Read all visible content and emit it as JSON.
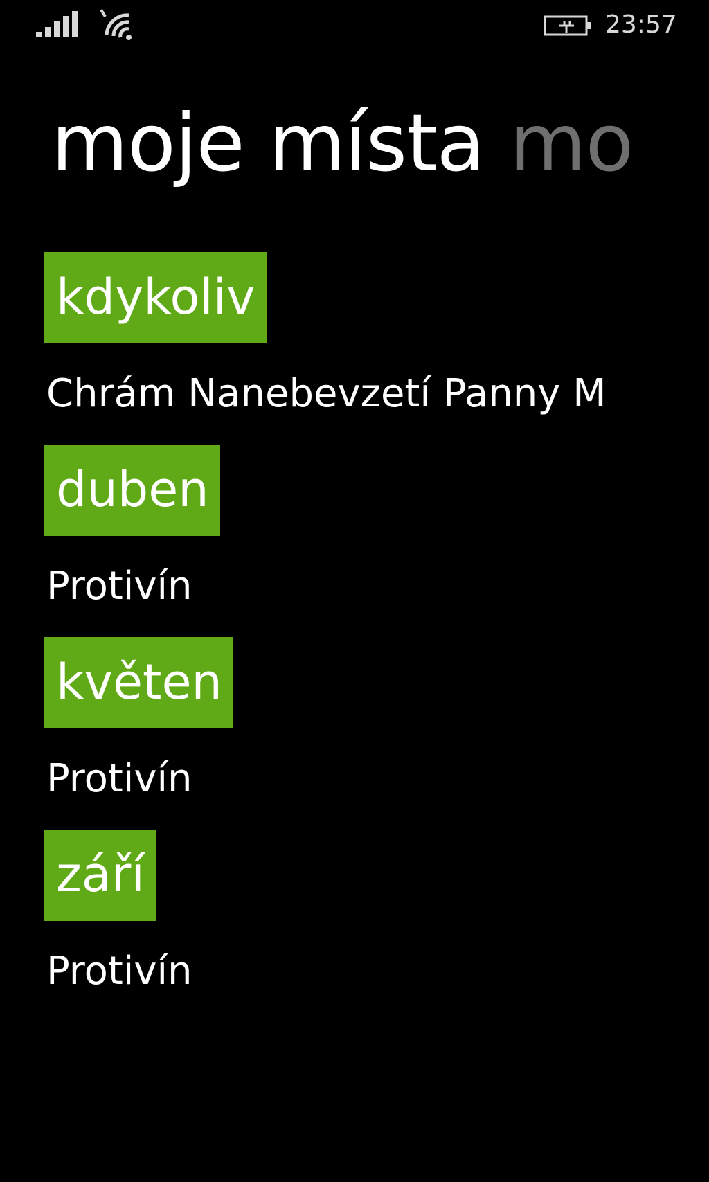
{
  "status_bar": {
    "time": "23:57",
    "icons": [
      "signal-icon",
      "wifi-icon",
      "battery-charging-icon"
    ]
  },
  "pivot": {
    "active_title": "moje místa",
    "next_title": "mo"
  },
  "colors": {
    "accent": "#60a917",
    "background": "#000000",
    "text": "#ffffff",
    "inactive_header": "#6f6f6f"
  },
  "groups": [
    {
      "label": "kdykoliv",
      "place": "Chrám Nanebevzetí Panny M"
    },
    {
      "label": "duben",
      "place": "Protivín"
    },
    {
      "label": "květen",
      "place": "Protivín"
    },
    {
      "label": "září",
      "place": "Protivín"
    }
  ]
}
